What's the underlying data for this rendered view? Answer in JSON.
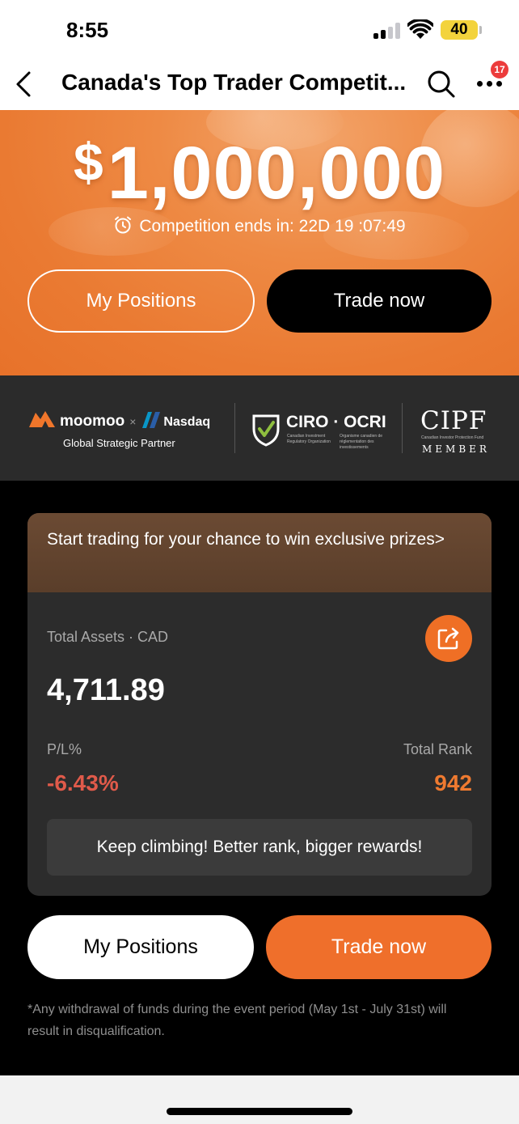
{
  "status_bar": {
    "time": "8:55",
    "battery": "40",
    "battery_color": "#f3d33c"
  },
  "nav": {
    "title": "Canada's Top Trader Competit...",
    "notification_count": "17",
    "icons": [
      "chevron-left-icon",
      "search-icon",
      "more-icon"
    ]
  },
  "hero": {
    "prize_currency": "$",
    "prize_amount": "1,000,000",
    "countdown": "Competition ends in: 22D 19 :07:49",
    "positions_label": "My Positions",
    "trade_label": "Trade now",
    "accent_color": "#ea7a32"
  },
  "partners": {
    "moomoo": "moomoo",
    "times": "×",
    "nasdaq": "Nasdaq",
    "caption": "Global Strategic Partner",
    "ciro": "CIRO · OCRI",
    "ciro_en": "Canadian Investment Regulatory Organization",
    "ciro_fr": "Organisme canadien de réglementation des investissements",
    "cipf": "CIPF",
    "cipf_sub": "Canadian Investor Protection Fund",
    "cipf_member": "MEMBER"
  },
  "card": {
    "header": "Start trading for your chance to win exclusive prizes>",
    "assets_label": "Total Assets · CAD",
    "assets_value": "4,711.89",
    "pl_label": "P/L%",
    "pl_value": "-6.43%",
    "rank_label": "Total Rank",
    "rank_value": "942",
    "promo": "Keep climbing! Better rank, bigger rewards!",
    "pl_color": "#e05a4a",
    "rank_color": "#ef7a30"
  },
  "actions": {
    "positions_label": "My Positions",
    "trade_label": "Trade now",
    "trade_color": "#ef6f2b"
  },
  "disclaimer": "*Any withdrawal of funds during the event period (May 1st - July 31st) will result in disqualification."
}
